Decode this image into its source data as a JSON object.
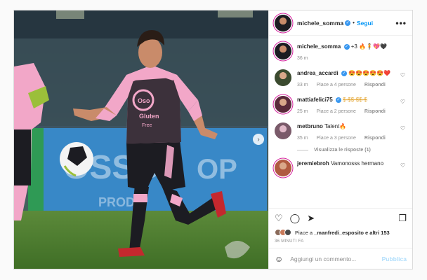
{
  "post": {
    "author": "michele_somma",
    "follow_label": "Segui",
    "more_label": "•••",
    "separator": "•",
    "verified_mark": "✓"
  },
  "caption": {
    "user": "michele_somma",
    "text": "+3 🔥🧍💖🖤",
    "time": "36 m"
  },
  "comments": [
    {
      "user": "andrea_accardi",
      "verified": true,
      "text": "😍😍😍😍😍❤️",
      "time": "33 m",
      "likes": "Piace a 4 persone",
      "reply": "Rispondi",
      "avatar_color": "#3b4a2f"
    },
    {
      "user": "mattiafelici75",
      "verified": true,
      "text": "$-$$-$$-$",
      "time": "25 m",
      "likes": "Piace a 2 persone",
      "reply": "Rispondi",
      "avatar_color": "#5a2a3a"
    },
    {
      "user": "metbruno",
      "verified": false,
      "text": "Talent🔥",
      "time": "35 m",
      "likes": "Piace a 3 persone",
      "reply": "Rispondi",
      "avatar_color": "#7a5a6a"
    },
    {
      "user": "jeremiebroh",
      "verified": false,
      "text": "Vamonosss hermano",
      "time": "",
      "likes": "",
      "reply": "",
      "avatar_color": "#b05a40"
    }
  ],
  "view_replies": "Visualizza le risposte (1)",
  "likes_line": {
    "prefix": "Piace a ",
    "user": "_manfredi_esposito",
    "suffix": " e altri 153"
  },
  "timestamp": "36 MINUTI FA",
  "composer": {
    "placeholder": "Aggiungi un commento...",
    "post_label": "Pubblica"
  },
  "icons": {
    "heart": "♡",
    "comment": "◯",
    "share": "➤",
    "bookmark": "❐",
    "emoji": "☺",
    "next": "›"
  },
  "colors": {
    "accent": "#0095f6",
    "jersey_pink": "#f2a7c8",
    "jersey_black": "#1c1c22"
  }
}
